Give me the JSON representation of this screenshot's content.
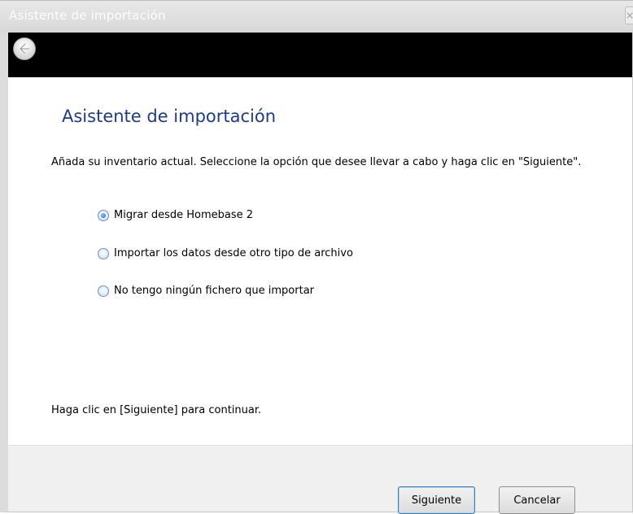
{
  "window": {
    "title": "Asistente de importación",
    "close_glyph": "×"
  },
  "nav": {
    "back_icon": "back-arrow-icon"
  },
  "main": {
    "heading": "Asistente de importación",
    "intro": "Añada  su inventario actual. Seleccione la opción que desee llevar a cabo y haga clic en \"Siguiente\".",
    "options": [
      {
        "label": "Migrar desde Homebase 2",
        "selected": true
      },
      {
        "label": "Importar los datos desde otro tipo de archivo",
        "selected": false
      },
      {
        "label": "No tengo ningún fichero que importar",
        "selected": false
      }
    ],
    "footer_hint": "Haga clic en  [Siguiente] para continuar."
  },
  "buttons": {
    "next_label": "Siguiente",
    "cancel_label": "Cancelar"
  },
  "colors": {
    "heading": "#1e3a8a",
    "navbar": "#000000",
    "bottombar": "#f0f0f0"
  }
}
